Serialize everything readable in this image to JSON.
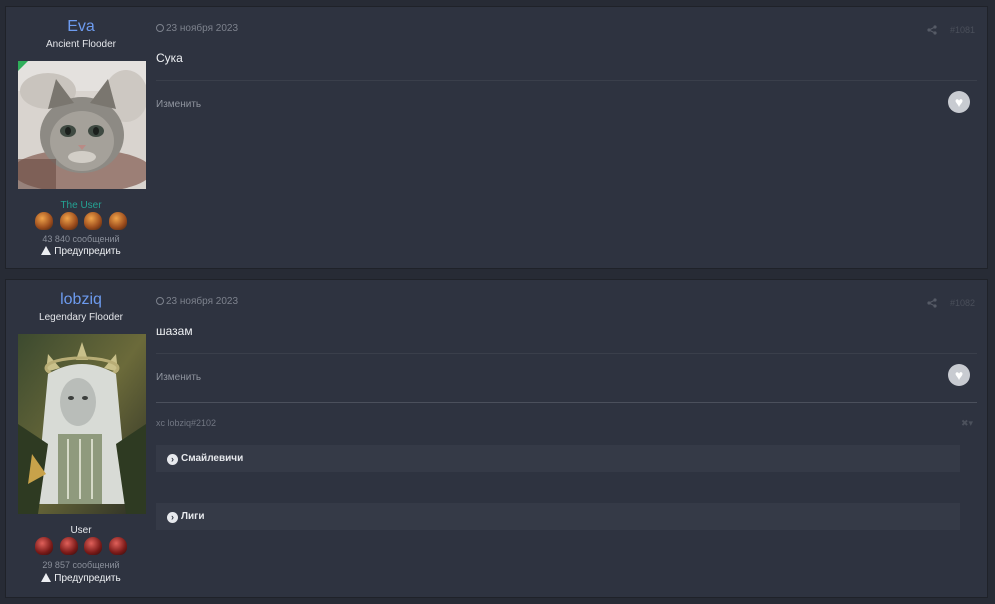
{
  "posts": [
    {
      "author": "Eva",
      "author_title": "Ancient Flooder",
      "group": "The User",
      "group_color": "#24a394",
      "post_count": "43 840 сообщений",
      "warn_label": "Предупредить",
      "date": "23 ноября 2023",
      "post_number": "#1081",
      "content": "Сука",
      "edit_label": "Изменить"
    },
    {
      "author": "lobziq",
      "author_title": "Legendary Flooder",
      "group": "User",
      "group_color": "#e8eaee",
      "post_count": "29 857 сообщений",
      "warn_label": "Предупредить",
      "date": "23 ноября 2023",
      "post_number": "#1082",
      "content": "шазам",
      "edit_label": "Изменить",
      "signature": {
        "text": "xc lobziq#2102",
        "spoilers": [
          "Смайлевичи",
          "Лиги"
        ]
      }
    }
  ],
  "icons": {
    "clock": "clock-icon",
    "share": "share-icon",
    "like": "heart-icon",
    "warn": "warning-icon",
    "chevron": "chevron-right-icon"
  },
  "colors": {
    "accent": "#6d9bef",
    "background": "#272b35",
    "panel": "#2e3340"
  }
}
